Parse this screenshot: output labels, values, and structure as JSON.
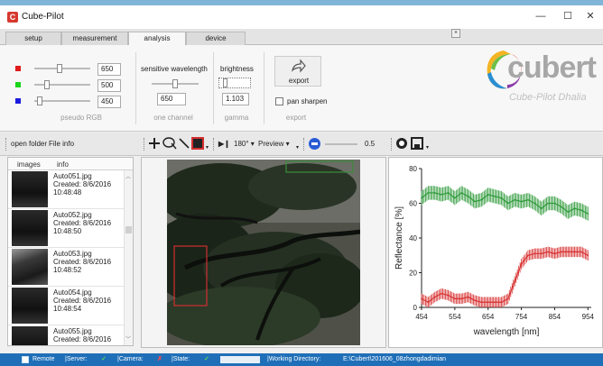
{
  "window": {
    "title": "Cube-Pilot",
    "app_icon": "C",
    "minimize": "—",
    "maximize": "☐",
    "close": "✕"
  },
  "tabs": [
    {
      "label": "setup"
    },
    {
      "label": "measurement"
    },
    {
      "label": "analysis"
    },
    {
      "label": "device"
    }
  ],
  "ribbon": {
    "close": "×",
    "pseudo_rgb": {
      "label": "pseudo RGB",
      "channels": [
        {
          "color": "#e01b1b",
          "value": "650",
          "level": 0.45
        },
        {
          "color": "#1bd41b",
          "value": "500",
          "level": 0.2
        },
        {
          "color": "#1b1be0",
          "value": "450",
          "level": 0.05
        }
      ]
    },
    "one_channel": {
      "title": "sensitive wavelength",
      "value": "650",
      "label": "one channel",
      "level": 0.5
    },
    "gamma": {
      "title": "brightness",
      "value": "1.103",
      "label": "gamma"
    },
    "export": {
      "button": "export",
      "pan_sharpen": "pan sharpen",
      "label": "export"
    },
    "logo": {
      "word": "cubert",
      "subtitle": "Cube-Pilot Dhalia"
    }
  },
  "toolbar": {
    "open_folder": "open folder",
    "file_info": "File info",
    "rotate": "180°",
    "preview": "Preview",
    "zoom_value": "0.5",
    "zoom_level": 0.3
  },
  "file_list": {
    "headers": [
      "images",
      "info"
    ],
    "items": [
      {
        "name": "Auto051.jpg",
        "created": "Created: 8/6/2016",
        "time": "10:48:48"
      },
      {
        "name": "Auto052.jpg",
        "created": "Created: 8/6/2016",
        "time": "10:48:50"
      },
      {
        "name": "Auto053.jpg",
        "created": "Created: 8/6/2016",
        "time": "10:48:52"
      },
      {
        "name": "Auto054.jpg",
        "created": "Created: 8/6/2016",
        "time": "10:48:54"
      },
      {
        "name": "Auto055.jpg",
        "created": "Created: 8/6/2016",
        "time": ""
      }
    ]
  },
  "chart_data": {
    "type": "line",
    "xlabel": "wavelength [nm]",
    "ylabel": "Reflectance [%]",
    "xlim": [
      454,
      964
    ],
    "ylim": [
      0,
      80
    ],
    "xticks": [
      454,
      554,
      654,
      754,
      854,
      954
    ],
    "yticks": [
      0,
      20,
      40,
      60,
      80
    ],
    "series": [
      {
        "color": "#2e9a3a",
        "x": [
          454,
          474,
          494,
          514,
          534,
          554,
          574,
          594,
          614,
          634,
          654,
          674,
          694,
          714,
          734,
          754,
          774,
          794,
          814,
          834,
          854,
          874,
          894,
          914,
          934,
          954
        ],
        "y": [
          63,
          66,
          66,
          65,
          66,
          63,
          66,
          64,
          61,
          62,
          65,
          64,
          63,
          60,
          62,
          61,
          62,
          60,
          57,
          60,
          60,
          58,
          55,
          57,
          56,
          54
        ],
        "err": 4
      },
      {
        "color": "#d83232",
        "x": [
          454,
          474,
          494,
          514,
          534,
          554,
          574,
          594,
          614,
          634,
          654,
          674,
          694,
          714,
          734,
          754,
          774,
          794,
          814,
          834,
          854,
          874,
          894,
          914,
          934,
          954
        ],
        "y": [
          5,
          3,
          6,
          8,
          7,
          5,
          5,
          6,
          4,
          3,
          3,
          3,
          3,
          5,
          15,
          25,
          30,
          31,
          31,
          32,
          31,
          32,
          32,
          32,
          32,
          30
        ],
        "err": 3
      }
    ]
  },
  "status": {
    "remote": "Remote",
    "server": "|Server:",
    "camera": "|Camera:",
    "state": "|State:",
    "working_dir_label": "|Working Directory:",
    "working_dir": "E:\\Cubert\\201606_08zhongdadimian",
    "server_ok": "✓",
    "camera_bad": "✗",
    "state_ok": "✓"
  }
}
